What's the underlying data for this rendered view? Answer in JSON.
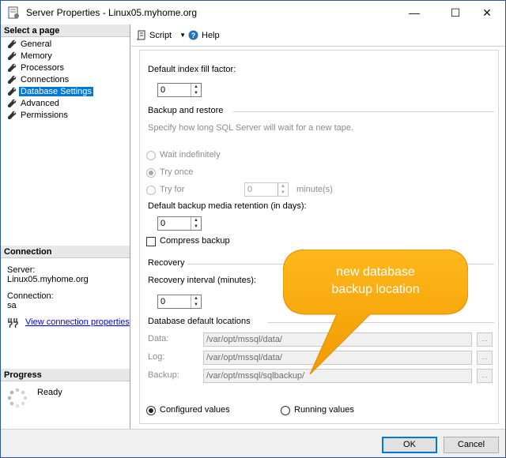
{
  "window": {
    "title": "Server Properties - Linux05.myhome.org",
    "controls": {
      "minimize": "—",
      "maximize": "☐",
      "close": "✕"
    }
  },
  "sidebar": {
    "select_page_header": "Select a page",
    "pages": [
      {
        "label": "General",
        "icon": "wrench-icon",
        "selected": false
      },
      {
        "label": "Memory",
        "icon": "wrench-icon",
        "selected": false
      },
      {
        "label": "Processors",
        "icon": "wrench-icon",
        "selected": false
      },
      {
        "label": "Connections",
        "icon": "wrench-icon",
        "selected": false
      },
      {
        "label": "Database Settings",
        "icon": "wrench-icon",
        "selected": true
      },
      {
        "label": "Advanced",
        "icon": "wrench-icon",
        "selected": false
      },
      {
        "label": "Permissions",
        "icon": "wrench-icon",
        "selected": false
      }
    ],
    "connection_header": "Connection",
    "server_label": "Server:",
    "server_value": "Linux05.myhome.org",
    "connection_label": "Connection:",
    "connection_value": "sa",
    "view_connection_link": "View connection properties",
    "progress_header": "Progress",
    "progress_status": "Ready"
  },
  "toolbar": {
    "script_label": "Script",
    "help_label": "Help"
  },
  "settings": {
    "fill_factor_label": "Default index fill factor:",
    "fill_factor_value": "0",
    "backup_restore_header": "Backup and restore",
    "tape_wait_desc": "Specify how long SQL Server will wait for a new tape.",
    "wait_indefinitely_label": "Wait indefinitely",
    "try_once_label": "Try once",
    "try_for_label": "Try for",
    "try_for_value": "0",
    "try_for_unit": "minute(s)",
    "retention_label": "Default backup media retention (in days):",
    "retention_value": "0",
    "compress_backup_label": "Compress backup",
    "recovery_header": "Recovery",
    "recovery_interval_label": "Recovery interval (minutes):",
    "recovery_interval_value": "0",
    "default_locations_header": "Database default locations",
    "data_label": "Data:",
    "data_path": "/var/opt/mssql/data/",
    "log_label": "Log:",
    "log_path": "/var/opt/mssql/data/",
    "backup_label": "Backup:",
    "backup_path": "/var/opt/mssql/sqlbackup/",
    "browse_label": "...",
    "configured_values_label": "Configured values",
    "running_values_label": "Running values"
  },
  "callout": {
    "line1": "new database",
    "line2": "backup location",
    "color": "#f4a000"
  },
  "footer": {
    "ok_label": "OK",
    "cancel_label": "Cancel"
  }
}
